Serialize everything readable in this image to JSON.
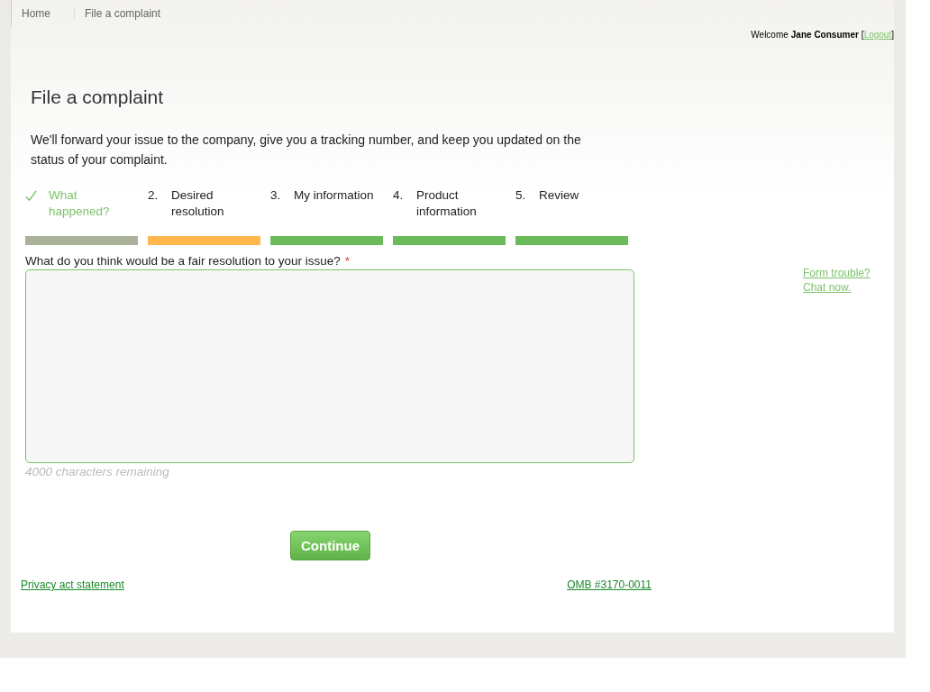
{
  "breadcrumb": [
    {
      "label": "Home"
    },
    {
      "label": "File a complaint"
    }
  ],
  "user_bar": {
    "welcome": "Welcome",
    "name": "Jane Consumer",
    "bracket_open": "[",
    "logout": "Logout",
    "bracket_close": "]"
  },
  "title": "File a complaint",
  "intro": "We'll forward your issue to the company, give you a tracking number, and keep you updated on the status of your complaint.",
  "steps": [
    {
      "label": "What happened?",
      "done": true,
      "selected": false
    },
    {
      "number": "2.",
      "label": "Desired resolution",
      "done": false,
      "selected": true
    },
    {
      "number": "3.",
      "label": "My information",
      "done": false,
      "selected": false
    },
    {
      "number": "4.",
      "label": "Product information",
      "done": false,
      "selected": false
    },
    {
      "number": "5.",
      "label": "Review",
      "done": false,
      "selected": false
    }
  ],
  "question": {
    "label": "What do you think would be a fair resolution to your issue?",
    "required_mark": "*",
    "remaining": "4000 characters remaining"
  },
  "help": {
    "line1": "Form trouble?",
    "line2": "Chat now."
  },
  "continue_button": "Continue",
  "footer": {
    "privacy": "Privacy act statement",
    "omb": "OMB #3170-0011"
  }
}
